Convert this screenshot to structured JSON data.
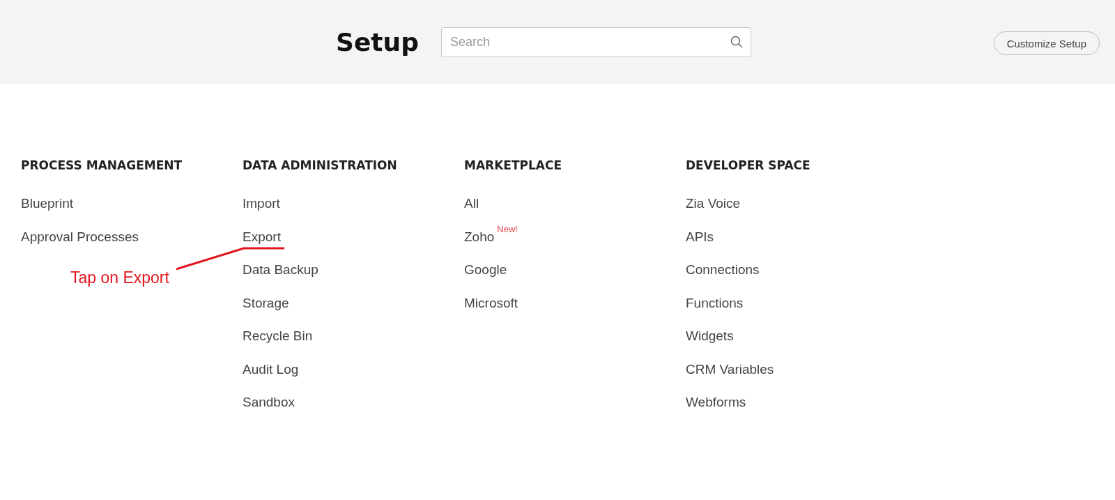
{
  "header": {
    "title": "Setup",
    "search": {
      "placeholder": "Search"
    },
    "customize_button": "Customize Setup"
  },
  "sections": [
    {
      "heading": "PROCESS MANAGEMENT",
      "items": [
        {
          "label": "Blueprint"
        },
        {
          "label": "Approval Processes"
        }
      ]
    },
    {
      "heading": "DATA ADMINISTRATION",
      "items": [
        {
          "label": "Import"
        },
        {
          "label": "Export"
        },
        {
          "label": "Data Backup"
        },
        {
          "label": "Storage"
        },
        {
          "label": "Recycle Bin"
        },
        {
          "label": "Audit Log"
        },
        {
          "label": "Sandbox"
        }
      ]
    },
    {
      "heading": "MARKETPLACE",
      "items": [
        {
          "label": "All"
        },
        {
          "label": "Zoho",
          "badge": "New!"
        },
        {
          "label": "Google"
        },
        {
          "label": "Microsoft"
        }
      ]
    },
    {
      "heading": "DEVELOPER SPACE",
      "items": [
        {
          "label": "Zia Voice"
        },
        {
          "label": "APIs"
        },
        {
          "label": "Connections"
        },
        {
          "label": "Functions"
        },
        {
          "label": "Widgets"
        },
        {
          "label": "CRM Variables"
        },
        {
          "label": "Webforms"
        }
      ]
    }
  ],
  "annotation": {
    "text": "Tap on Export"
  }
}
